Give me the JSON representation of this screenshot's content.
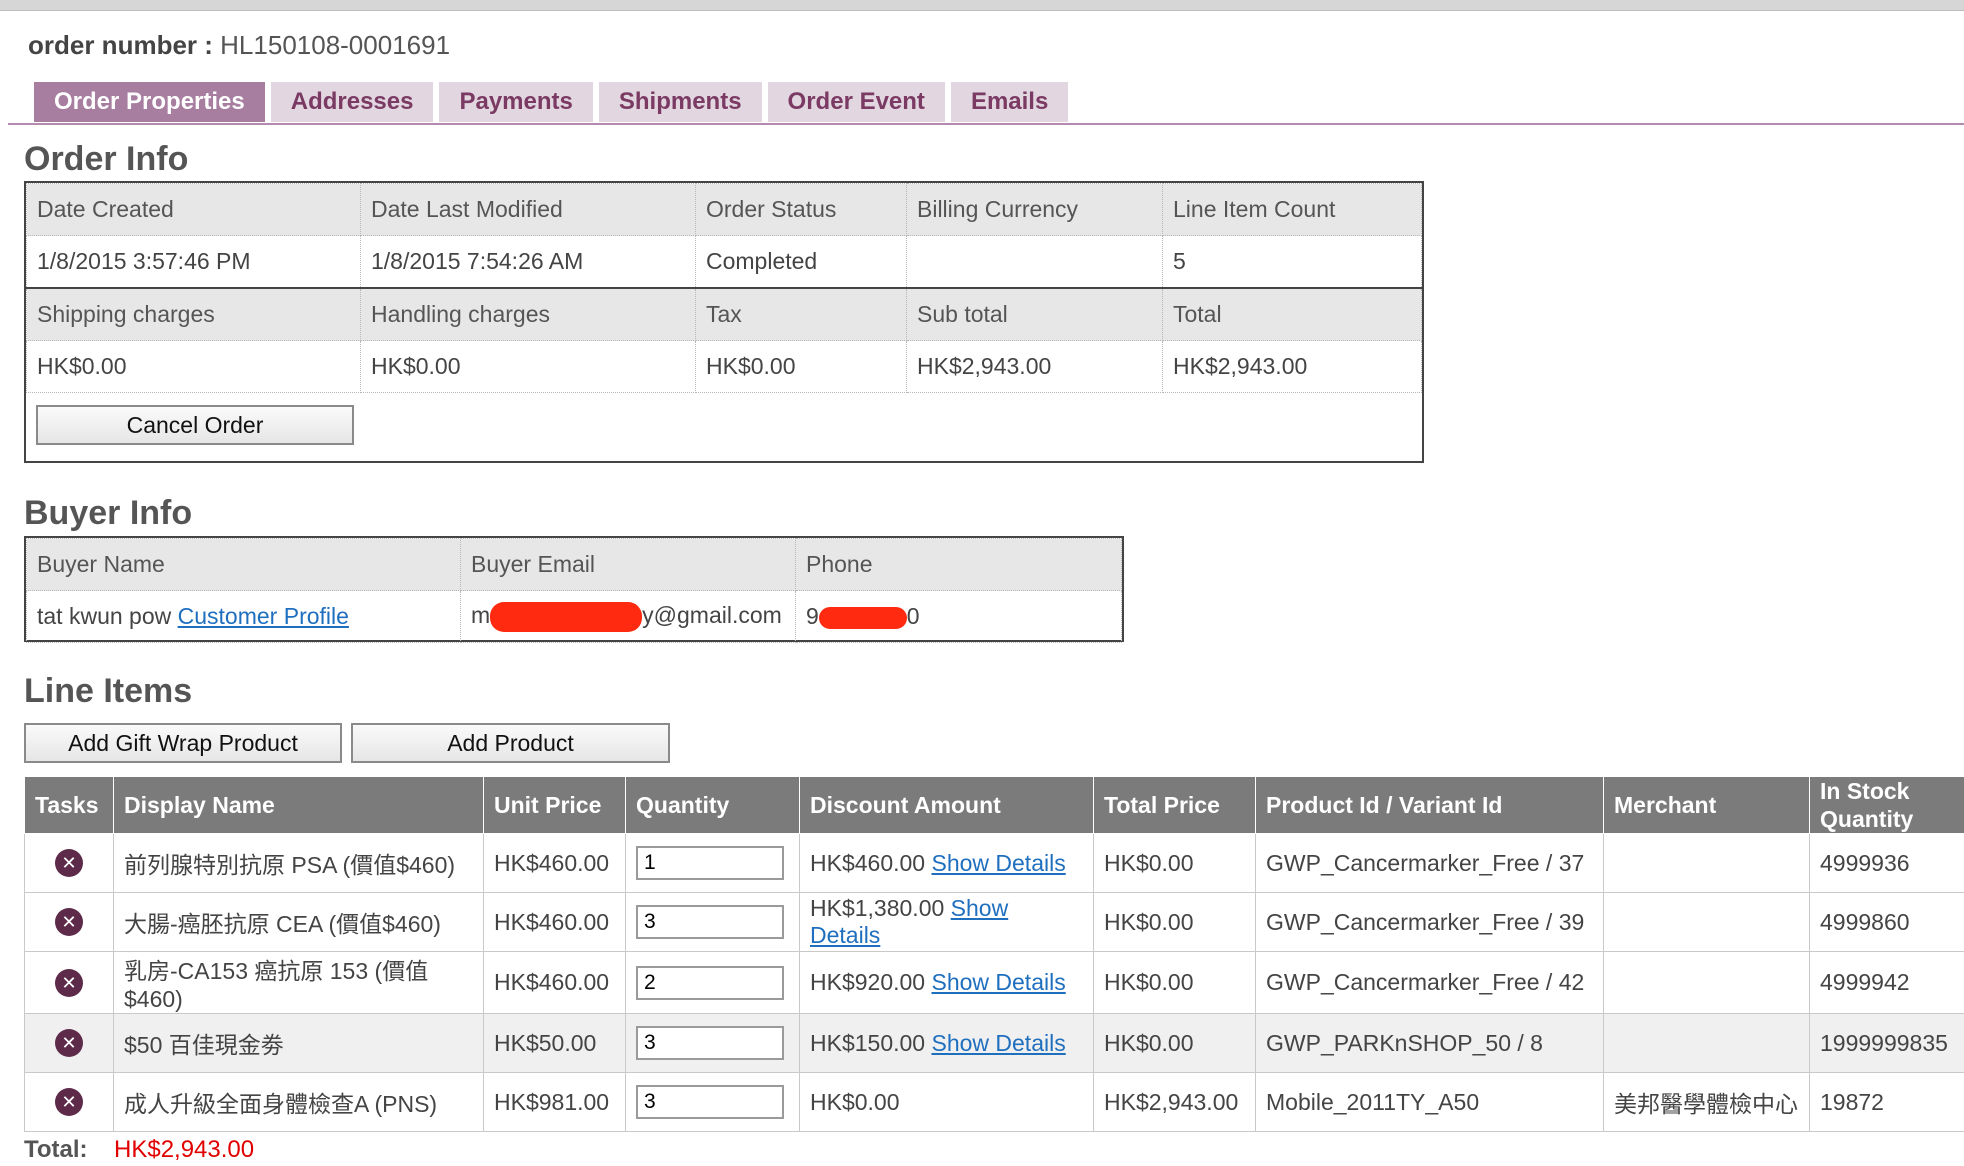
{
  "order": {
    "number_label": "order number :",
    "number_value": "HL150108-0001691"
  },
  "tabs": [
    {
      "label": "Order Properties",
      "active": true
    },
    {
      "label": "Addresses"
    },
    {
      "label": "Payments"
    },
    {
      "label": "Shipments"
    },
    {
      "label": "Order Event"
    },
    {
      "label": "Emails"
    }
  ],
  "order_info": {
    "title": "Order Info",
    "headers1": [
      "Date Created",
      "Date Last Modified",
      "Order Status",
      "Billing Currency",
      "Line Item Count"
    ],
    "values1": [
      "1/8/2015 3:57:46 PM",
      "1/8/2015 7:54:26 AM",
      "Completed",
      "",
      "5"
    ],
    "headers2": [
      "Shipping charges",
      "Handling charges",
      "Tax",
      "Sub total",
      "Total"
    ],
    "values2": [
      "HK$0.00",
      "HK$0.00",
      "HK$0.00",
      "HK$2,943.00",
      "HK$2,943.00"
    ],
    "cancel_label": "Cancel Order"
  },
  "buyer_info": {
    "title": "Buyer Info",
    "headers": [
      "Buyer Name",
      "Buyer Email",
      "Phone"
    ],
    "name": "tat kwun pow",
    "profile_link": "Customer Profile",
    "email_start": "m",
    "email_end": "y@gmail.com",
    "phone_start": "9",
    "phone_end": "0"
  },
  "line_items": {
    "title": "Line Items",
    "add_gift_wrap_label": "Add Gift Wrap Product",
    "add_product_label": "Add Product",
    "headers": {
      "tasks": "Tasks",
      "display_name": "Display Name",
      "unit_price": "Unit Price",
      "quantity": "Quantity",
      "discount_amount": "Discount Amount",
      "total_price": "Total Price",
      "product_id": "Product Id / Variant Id",
      "merchant": "Merchant",
      "in_stock": "In Stock Quantity"
    },
    "show_details_label": "Show Details",
    "rows": [
      {
        "name": "前列腺特別抗原 PSA (價值$460)",
        "unit_price": "HK$460.00",
        "quantity": "1",
        "discount": "HK$460.00",
        "total": "HK$0.00",
        "product_id": "GWP_Cancermarker_Free / 37",
        "merchant": "",
        "stock": "4999936"
      },
      {
        "name": "大腸-癌胚抗原 CEA (價值$460)",
        "unit_price": "HK$460.00",
        "quantity": "3",
        "discount": "HK$1,380.00",
        "total": "HK$0.00",
        "product_id": "GWP_Cancermarker_Free / 39",
        "merchant": "",
        "stock": "4999860"
      },
      {
        "name": "乳房-CA153 癌抗原 153 (價值$460)",
        "unit_price": "HK$460.00",
        "quantity": "2",
        "discount": "HK$920.00",
        "total": "HK$0.00",
        "product_id": "GWP_Cancermarker_Free / 42",
        "merchant": "",
        "stock": "4999942"
      },
      {
        "name": "$50 百佳現金劵",
        "unit_price": "HK$50.00",
        "quantity": "3",
        "discount": "HK$150.00",
        "total": "HK$0.00",
        "product_id": "GWP_PARKnSHOP_50 / 8",
        "merchant": "",
        "stock": "1999999835"
      },
      {
        "name": "成人升級全面身體檢查A (PNS)",
        "unit_price": "HK$981.00",
        "quantity": "3",
        "discount": "HK$0.00",
        "total": "HK$2,943.00",
        "product_id": "Mobile_2011TY_A50",
        "merchant": "美邦醫學體檢中心",
        "stock": "19872"
      }
    ],
    "total_label": "Total:",
    "total_value": "HK$2,943.00"
  },
  "colors": {
    "tab_active": "#a77da0",
    "tab_inactive": "#e2d7e0",
    "header_bg": "#7b7b7b",
    "link": "#1f6fbf",
    "total_red": "#e00000",
    "remove_icon": "#5d2a4a"
  },
  "icons": {
    "remove": "x-circle-icon"
  }
}
